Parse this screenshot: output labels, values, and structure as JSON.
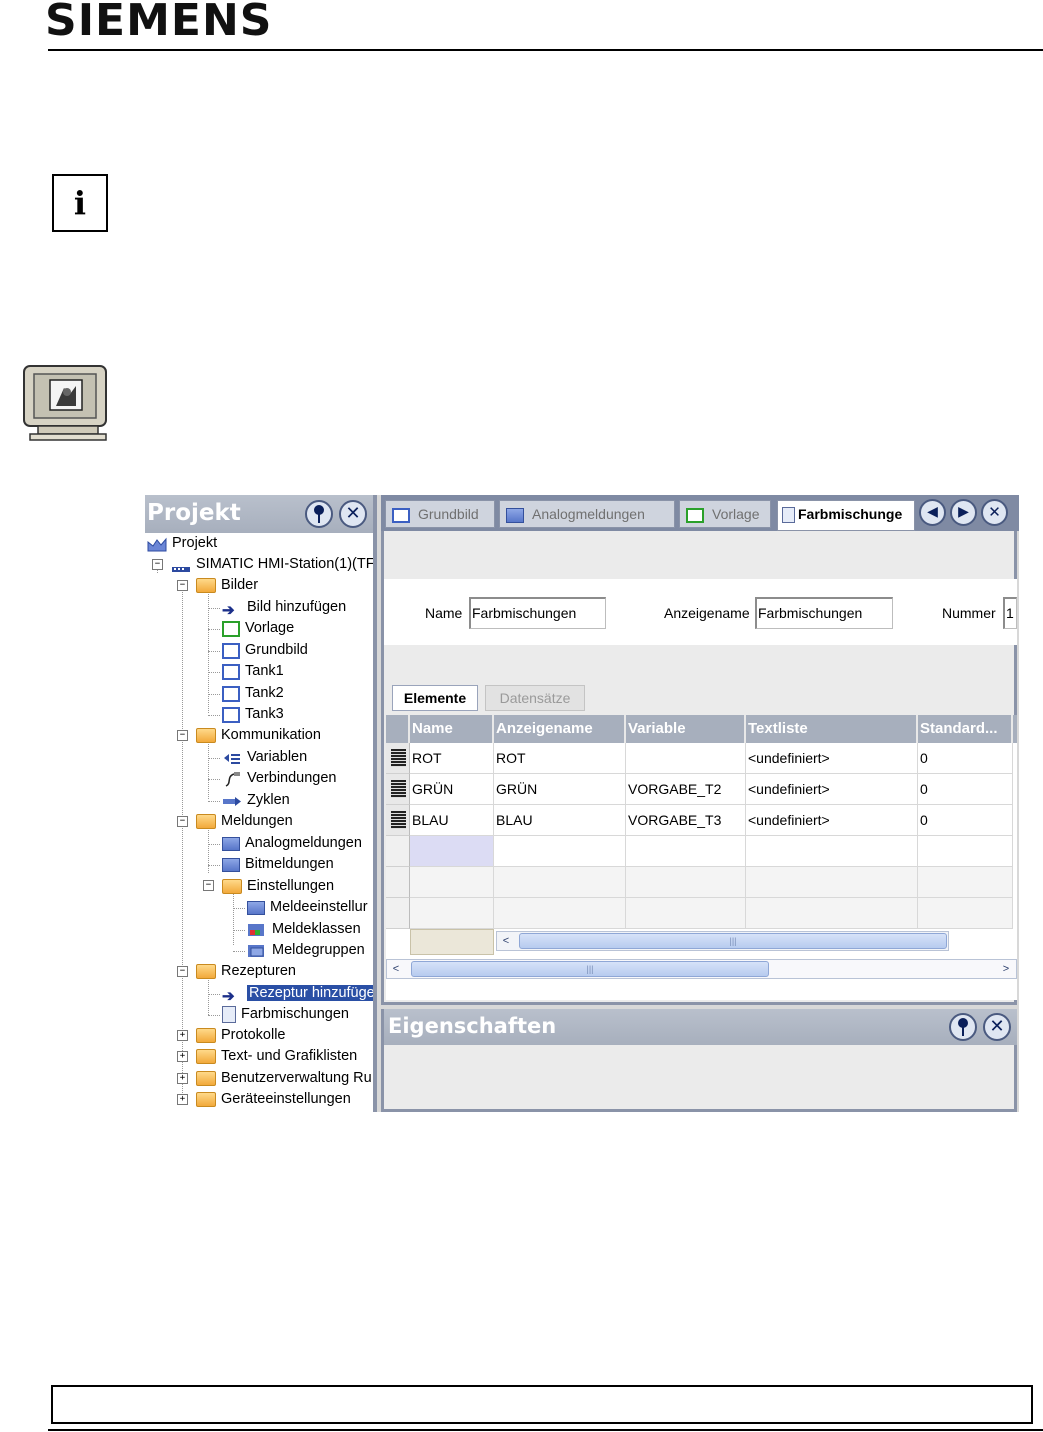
{
  "header": {
    "logo": "SIEMENS"
  },
  "info_icon": {
    "glyph": "i"
  },
  "project_panel": {
    "title": "Projekt",
    "pin_icon": "pin-icon",
    "close_icon": "close-icon",
    "tree": [
      {
        "label": "Projekt",
        "icon": "project-icon"
      },
      {
        "label": "SIMATIC HMI-Station(1)(TF",
        "icon": "hmi-station-icon",
        "expander": "−"
      },
      {
        "label": "Bilder",
        "icon": "folder-icon",
        "expander": "−"
      },
      {
        "label": "Bild hinzufügen",
        "icon": "add-arrow-icon"
      },
      {
        "label": "Vorlage",
        "icon": "template-screen-icon"
      },
      {
        "label": "Grundbild",
        "icon": "screen-icon"
      },
      {
        "label": "Tank1",
        "icon": "screen-icon"
      },
      {
        "label": "Tank2",
        "icon": "screen-icon"
      },
      {
        "label": "Tank3",
        "icon": "screen-icon"
      },
      {
        "label": "Kommunikation",
        "icon": "folder-icon",
        "expander": "−"
      },
      {
        "label": "Variablen",
        "icon": "tags-icon"
      },
      {
        "label": "Verbindungen",
        "icon": "connection-icon"
      },
      {
        "label": "Zyklen",
        "icon": "cycle-icon"
      },
      {
        "label": "Meldungen",
        "icon": "folder-icon",
        "expander": "−"
      },
      {
        "label": "Analogmeldungen",
        "icon": "alarm-icon"
      },
      {
        "label": "Bitmeldungen",
        "icon": "alarm-icon"
      },
      {
        "label": "Einstellungen",
        "icon": "folder-icon",
        "expander": "−"
      },
      {
        "label": "Meldeeinstellur",
        "icon": "alarm-settings-icon"
      },
      {
        "label": "Meldeklassen",
        "icon": "alarm-class-icon"
      },
      {
        "label": "Meldegruppen",
        "icon": "alarm-group-icon"
      },
      {
        "label": "Rezepturen",
        "icon": "folder-icon",
        "expander": "−"
      },
      {
        "label": "Rezeptur hinzufüge",
        "icon": "add-arrow-icon",
        "selected": true
      },
      {
        "label": "Farbmischungen",
        "icon": "recipe-icon"
      },
      {
        "label": "Protokolle",
        "icon": "folder-icon",
        "expander": "+"
      },
      {
        "label": "Text- und Grafiklisten",
        "icon": "folder-icon",
        "expander": "+"
      },
      {
        "label": "Benutzerverwaltung Ru",
        "icon": "folder-icon",
        "expander": "+"
      },
      {
        "label": "Geräteeinstellungen",
        "icon": "folder-icon",
        "expander": "+"
      }
    ]
  },
  "tabs": [
    {
      "label": "Grundbild",
      "icon": "screen-icon"
    },
    {
      "label": "Analogmeldungen",
      "icon": "alarm-icon"
    },
    {
      "label": "Vorlage",
      "icon": "template-screen-icon"
    },
    {
      "label": "Farbmischunge",
      "icon": "recipe-icon",
      "active": true
    }
  ],
  "tab_nav": {
    "prev": "◀",
    "next": "▶",
    "close": "✕"
  },
  "recipe_form": {
    "name_label": "Name",
    "name_value": "Farbmischungen",
    "display_label": "Anzeigename",
    "display_value": "Farbmischungen",
    "number_label": "Nummer",
    "number_value": "1"
  },
  "subtabs": {
    "elements": "Elemente",
    "records": "Datensätze"
  },
  "grid": {
    "columns": [
      "Name",
      "Anzeigename",
      "Variable",
      "Textliste",
      "Standard..."
    ],
    "rows": [
      [
        "ROT",
        "ROT",
        "",
        "<undefiniert>",
        "0"
      ],
      [
        "GRÜN",
        "GRÜN",
        "VORGABE_T2",
        "<undefiniert>",
        "0"
      ],
      [
        "BLAU",
        "BLAU",
        "VORGABE_T3",
        "<undefiniert>",
        "0"
      ]
    ]
  },
  "properties_panel": {
    "title": "Eigenschaften"
  },
  "colors": {
    "panel_header": "#a7afbd",
    "selection": "#2a4fa5",
    "tab_bar": "#7f8aa3"
  }
}
